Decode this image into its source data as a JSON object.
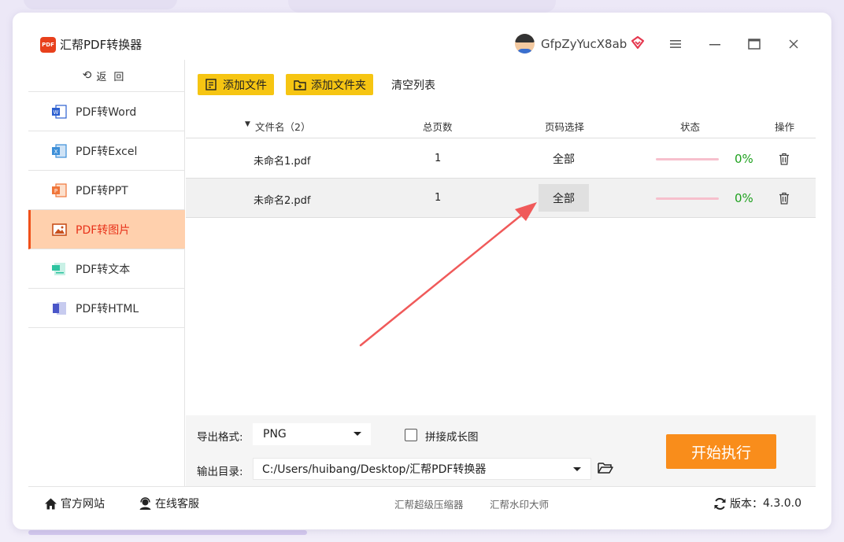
{
  "app": {
    "title": "汇帮PDF转换器",
    "logo_text": "PDF",
    "username": "GfpZyYucX8ab",
    "window_buttons": {
      "menu": "≡",
      "minimize": "—",
      "maximize": "□",
      "close": "✕"
    }
  },
  "sidebar": {
    "back_arrow": "⟲",
    "back_label": "返回",
    "items": [
      {
        "label": "PDF转Word",
        "icon": "word-icon",
        "color": "#2b5fd0",
        "active": false
      },
      {
        "label": "PDF转Excel",
        "icon": "excel-icon",
        "color": "#3d8fd8",
        "active": false
      },
      {
        "label": "PDF转PPT",
        "icon": "ppt-icon",
        "color": "#f0763a",
        "active": false
      },
      {
        "label": "PDF转图片",
        "icon": "image-icon",
        "color": "#c8501c",
        "active": true
      },
      {
        "label": "PDF转文本",
        "icon": "text-icon",
        "color": "#2ec4a0",
        "active": false
      },
      {
        "label": "PDF转HTML",
        "icon": "html-icon",
        "color": "#4a56c8",
        "active": false
      }
    ]
  },
  "toolbar": {
    "add_file": "添加文件",
    "add_folder": "添加文件夹",
    "clear_list": "清空列表"
  },
  "table": {
    "headers": {
      "sort_icon": "▼",
      "filename": "文件名（2）",
      "pages": "总页数",
      "page_select": "页码选择",
      "status": "状态",
      "actions": "操作"
    },
    "rows": [
      {
        "filename": "未命名1.pdf",
        "pages": "1",
        "page_select": "全部",
        "progress": 0,
        "percent": "0%",
        "selected": false
      },
      {
        "filename": "未命名2.pdf",
        "pages": "1",
        "page_select": "全部",
        "progress": 0,
        "percent": "0%",
        "selected": true
      }
    ]
  },
  "options": {
    "format_label": "导出格式:",
    "format_value": "PNG",
    "stitch_label": "拼接成长图",
    "stitch_checked": false,
    "output_label": "输出目录:",
    "output_value": "C:/Users/huibang/Desktop/汇帮PDF转换器",
    "start_button": "开始执行"
  },
  "footer": {
    "website": "官方网站",
    "support": "在线客服",
    "link1": "汇帮超级压缩器",
    "link2": "汇帮水印大师",
    "version_label": "版本：",
    "version_value": "4.3.0.0"
  },
  "colors": {
    "accent_yellow": "#f6c512",
    "start_orange": "#f98d1b",
    "active_bg": "#ffd0ad",
    "active_text": "#e8321a",
    "percent_green": "#1fa11f",
    "annotation_arrow": "#f05a5a"
  }
}
